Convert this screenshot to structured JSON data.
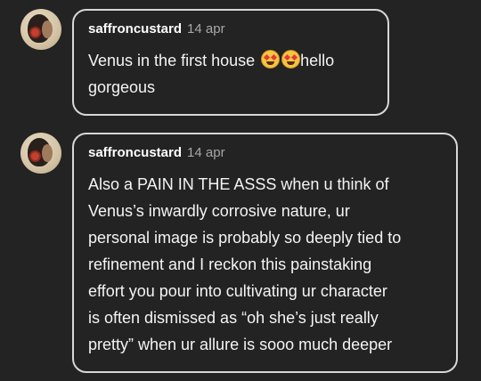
{
  "messages": [
    {
      "username": "saffroncustard",
      "date": "14 apr",
      "lines": [
        "Venus in the first house",
        "gorgeous"
      ],
      "inline_emojis": [
        "star-struck-emoji",
        "star-struck-emoji"
      ],
      "trailing_text": "hello"
    },
    {
      "username": "saffroncustard",
      "date": "14 apr",
      "lines": [
        "Also a PAIN IN THE ASSS when u think of",
        "Venus’s inwardly corrosive nature, ur",
        "personal image is probably so deeply tied to",
        "refinement and I reckon this painstaking",
        "effort you pour into cultivating ur character",
        "is often dismissed as “oh she’s just really",
        "pretty” when ur allure is sooo much deeper"
      ]
    }
  ]
}
